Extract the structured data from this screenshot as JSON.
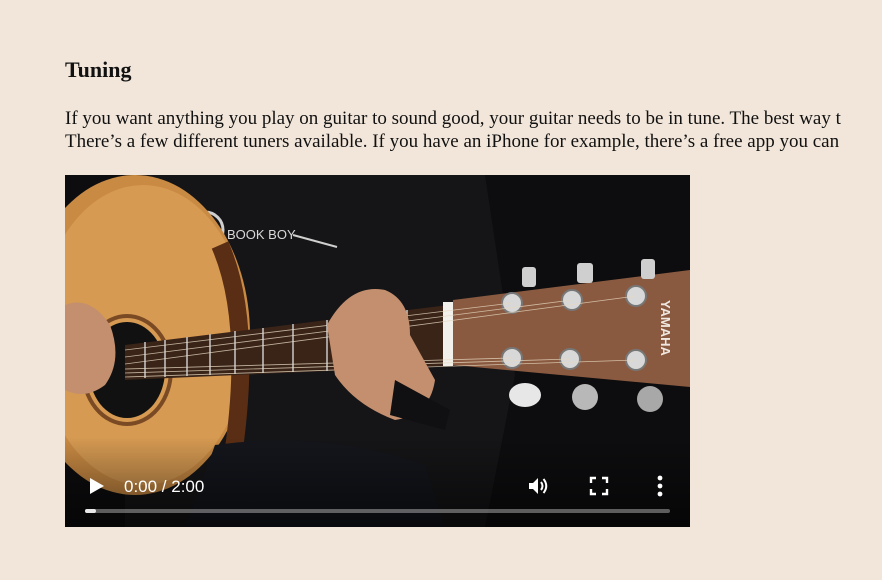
{
  "section": {
    "heading": "Tuning",
    "paragraph_lines": [
      "If you want anything you play on guitar to sound good, your guitar needs to be in tune. The best way t",
      "There’s a few different tuners available. If you have an iPhone for example, there’s a free app you can"
    ]
  },
  "video": {
    "shirt_logo_text": "BOOK BOY",
    "headstock_brand": "YAMAHA",
    "controls": {
      "play_icon": "play-icon",
      "time": "0:00 / 2:00",
      "volume_icon": "volume-icon",
      "fullscreen_icon": "fullscreen-icon",
      "more_icon": "more-options-icon",
      "progress_fraction": 0
    }
  },
  "colors": {
    "page_background": "#f2e6da",
    "video_background": "#0b0b0c",
    "guitar_body": "#c9883f",
    "headstock": "#8a5a40"
  }
}
